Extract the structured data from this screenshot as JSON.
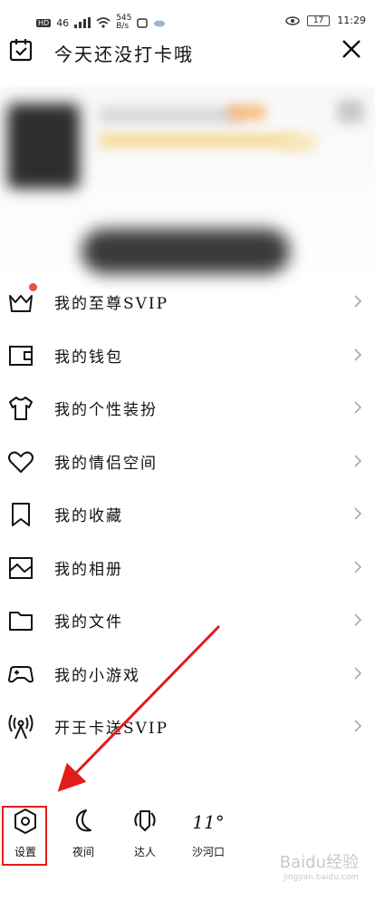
{
  "status_bar": {
    "hd_label": "HD",
    "network": "46",
    "speed_value": "545",
    "speed_unit": "B/s",
    "battery": "17",
    "time": "11:29"
  },
  "header": {
    "title": "今天还没打卡哦"
  },
  "menu": [
    {
      "label": "我的至尊SVIP",
      "icon": "crown-icon",
      "badge": true
    },
    {
      "label": "我的钱包",
      "icon": "wallet-icon"
    },
    {
      "label": "我的个性装扮",
      "icon": "tshirt-icon"
    },
    {
      "label": "我的情侣空间",
      "icon": "heart-icon"
    },
    {
      "label": "我的收藏",
      "icon": "bookmark-icon"
    },
    {
      "label": "我的相册",
      "icon": "image-icon"
    },
    {
      "label": "我的文件",
      "icon": "folder-icon"
    },
    {
      "label": "我的小游戏",
      "icon": "gamepad-icon"
    },
    {
      "label": "开王卡送SVIP",
      "icon": "antenna-icon"
    }
  ],
  "bottom_tabs": [
    {
      "label": "设置",
      "icon": "settings-hexagon-icon"
    },
    {
      "label": "夜间",
      "icon": "moon-icon"
    },
    {
      "label": "达人",
      "icon": "badge-wings-icon"
    },
    {
      "label": "沙河口",
      "icon": "weather-icon",
      "glyph": "11°"
    }
  ],
  "accent_colors": {
    "badge": "#e5533b",
    "highlight_box": "#e31b1b",
    "arrow": "#e31b1b"
  },
  "watermark": {
    "text": "Baidu经验",
    "sub": "jingyan.baidu.com"
  }
}
